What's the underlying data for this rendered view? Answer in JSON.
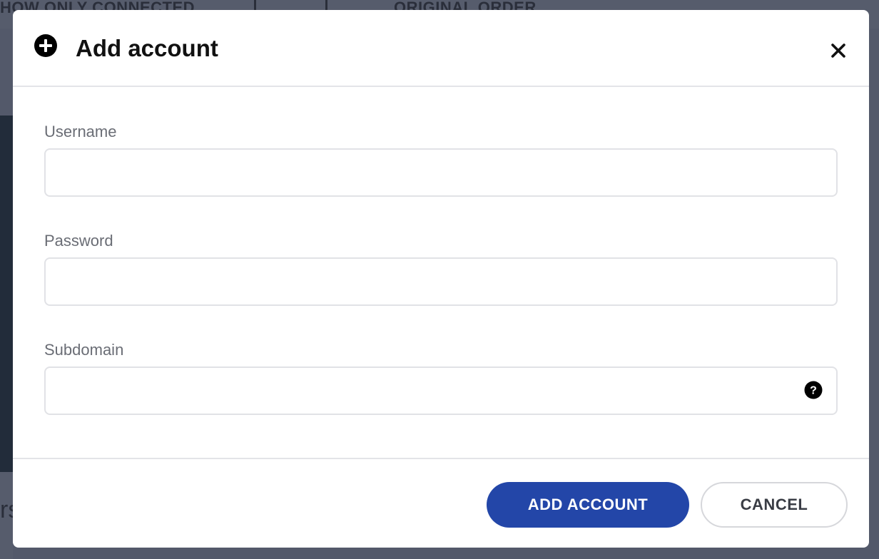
{
  "background": {
    "filter_text": "HOW ONLY CONNECTED",
    "order_text": "ORIGINAL ORDER",
    "fragment_text": "rs"
  },
  "modal": {
    "title": "Add account",
    "header_icon": "plus-circle-icon",
    "close_icon": "close-icon",
    "fields": {
      "username": {
        "label": "Username",
        "value": "",
        "placeholder": ""
      },
      "password": {
        "label": "Password",
        "value": "",
        "placeholder": ""
      },
      "subdomain": {
        "label": "Subdomain",
        "value": "",
        "placeholder": "",
        "help_icon": "question-circle-icon"
      }
    },
    "buttons": {
      "add_account": "ADD ACCOUNT",
      "cancel": "CANCEL"
    }
  },
  "colors": {
    "primary": "#2346a8",
    "border": "#e1e2e6",
    "overlay": "#5a6172"
  }
}
